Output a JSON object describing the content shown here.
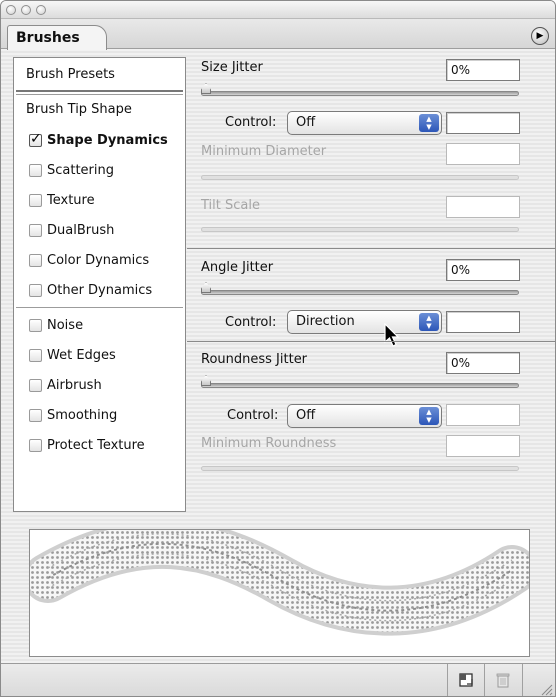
{
  "panel": {
    "tab_label": "Brushes"
  },
  "sidebar": {
    "presets_label": "Brush Presets",
    "tip_shape_label": "Brush Tip Shape",
    "items": [
      {
        "label": "Shape Dynamics",
        "checked": true
      },
      {
        "label": "Scattering",
        "checked": false
      },
      {
        "label": "Texture",
        "checked": false
      },
      {
        "label": "DualBrush",
        "checked": false
      },
      {
        "label": "Color Dynamics",
        "checked": false
      },
      {
        "label": "Other Dynamics",
        "checked": false
      },
      {
        "label": "Noise",
        "checked": false
      },
      {
        "label": "Wet Edges",
        "checked": false
      },
      {
        "label": "Airbrush",
        "checked": false
      },
      {
        "label": "Smoothing",
        "checked": false
      },
      {
        "label": "Protect  Texture",
        "checked": false
      }
    ]
  },
  "settings": {
    "size_jitter": {
      "label": "Size Jitter",
      "value": "0%"
    },
    "size_control": {
      "label": "Control:",
      "value": "Off"
    },
    "min_diameter": {
      "label": "Minimum Diameter",
      "value": ""
    },
    "tilt_scale": {
      "label": "Tilt Scale",
      "value": ""
    },
    "angle_jitter": {
      "label": "Angle Jitter",
      "value": "0%"
    },
    "angle_control": {
      "label": "Control:",
      "value": "Direction"
    },
    "roundness_jitter": {
      "label": "Roundness Jitter",
      "value": "0%"
    },
    "roundness_control": {
      "label": "Control:",
      "value": "Off"
    },
    "min_roundness": {
      "label": "Minimum Roundness",
      "value": ""
    }
  },
  "icons": {
    "menu": "panel-menu-icon",
    "new": "new-brush-icon",
    "trash": "trash-icon",
    "grip": "resize-grip-icon"
  }
}
